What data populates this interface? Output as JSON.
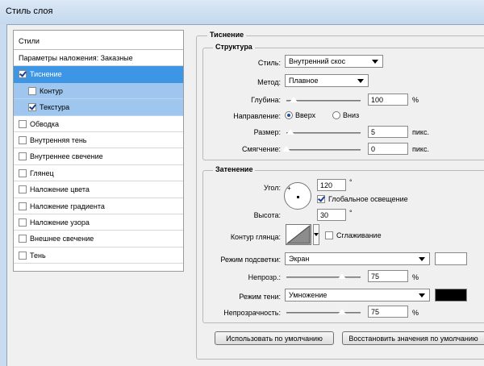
{
  "window": {
    "title": "Стиль слоя"
  },
  "styles": {
    "header": "Стили",
    "items": [
      {
        "label": "Параметры наложения: Заказные",
        "checkbox": false,
        "checked": false
      },
      {
        "label": "Тиснение",
        "checkbox": true,
        "checked": true
      },
      {
        "label": "Контур",
        "checkbox": true,
        "checked": false
      },
      {
        "label": "Текстура",
        "checkbox": true,
        "checked": true
      },
      {
        "label": "Обводка",
        "checkbox": true,
        "checked": false
      },
      {
        "label": "Внутренняя тень",
        "checkbox": true,
        "checked": false
      },
      {
        "label": "Внутреннее свечение",
        "checkbox": true,
        "checked": false
      },
      {
        "label": "Глянец",
        "checkbox": true,
        "checked": false
      },
      {
        "label": "Наложение цвета",
        "checkbox": true,
        "checked": false
      },
      {
        "label": "Наложение градиента",
        "checkbox": true,
        "checked": false
      },
      {
        "label": "Наложение узора",
        "checkbox": true,
        "checked": false
      },
      {
        "label": "Внешнее свечение",
        "checkbox": true,
        "checked": false
      },
      {
        "label": "Тень",
        "checkbox": true,
        "checked": false
      }
    ]
  },
  "emboss": {
    "title": "Тиснение",
    "structure": {
      "title": "Структура",
      "style_label": "Стиль:",
      "style_value": "Внутренний скос",
      "method_label": "Метод:",
      "method_value": "Плавное",
      "depth_label": "Глубина:",
      "depth_value": "100",
      "depth_unit": "%",
      "depth_level": 0.1,
      "direction_label": "Направление:",
      "direction_up": "Вверх",
      "direction_down": "Вниз",
      "size_label": "Размер:",
      "size_value": "5",
      "size_unit": "пикс.",
      "size_level": 0.05,
      "soften_label": "Смягчение:",
      "soften_value": "0",
      "soften_unit": "пикс.",
      "soften_level": 0.0
    },
    "shading": {
      "title": "Затенение",
      "angle_label": "Угол:",
      "angle_value": "120",
      "angle_unit": "°",
      "global_light_label": "Глобальное освещение",
      "altitude_label": "Высота:",
      "altitude_value": "30",
      "altitude_unit": "°",
      "gloss_contour_label": "Контур глянца:",
      "antialias_label": "Сглаживание",
      "highlight_mode_label": "Режим подсветки:",
      "highlight_mode_value": "Экран",
      "highlight_color": "#ffffff",
      "highlight_opacity_label": "Непрозр.:",
      "highlight_opacity_value": "75",
      "highlight_opacity_unit": "%",
      "highlight_opacity_level": 0.75,
      "shadow_mode_label": "Режим тени:",
      "shadow_mode_value": "Умножение",
      "shadow_color": "#000000",
      "shadow_opacity_label": "Непрозрачность:",
      "shadow_opacity_value": "75",
      "shadow_opacity_unit": "%",
      "shadow_opacity_level": 0.75
    }
  },
  "buttons": {
    "default": "Использовать по умолчанию",
    "restore": "Восстановить значения по умолчанию"
  },
  "colors": {
    "selection": "#3d95e6",
    "sub_selection": "#9ec6ee",
    "title_bar": "#c9dcef"
  }
}
